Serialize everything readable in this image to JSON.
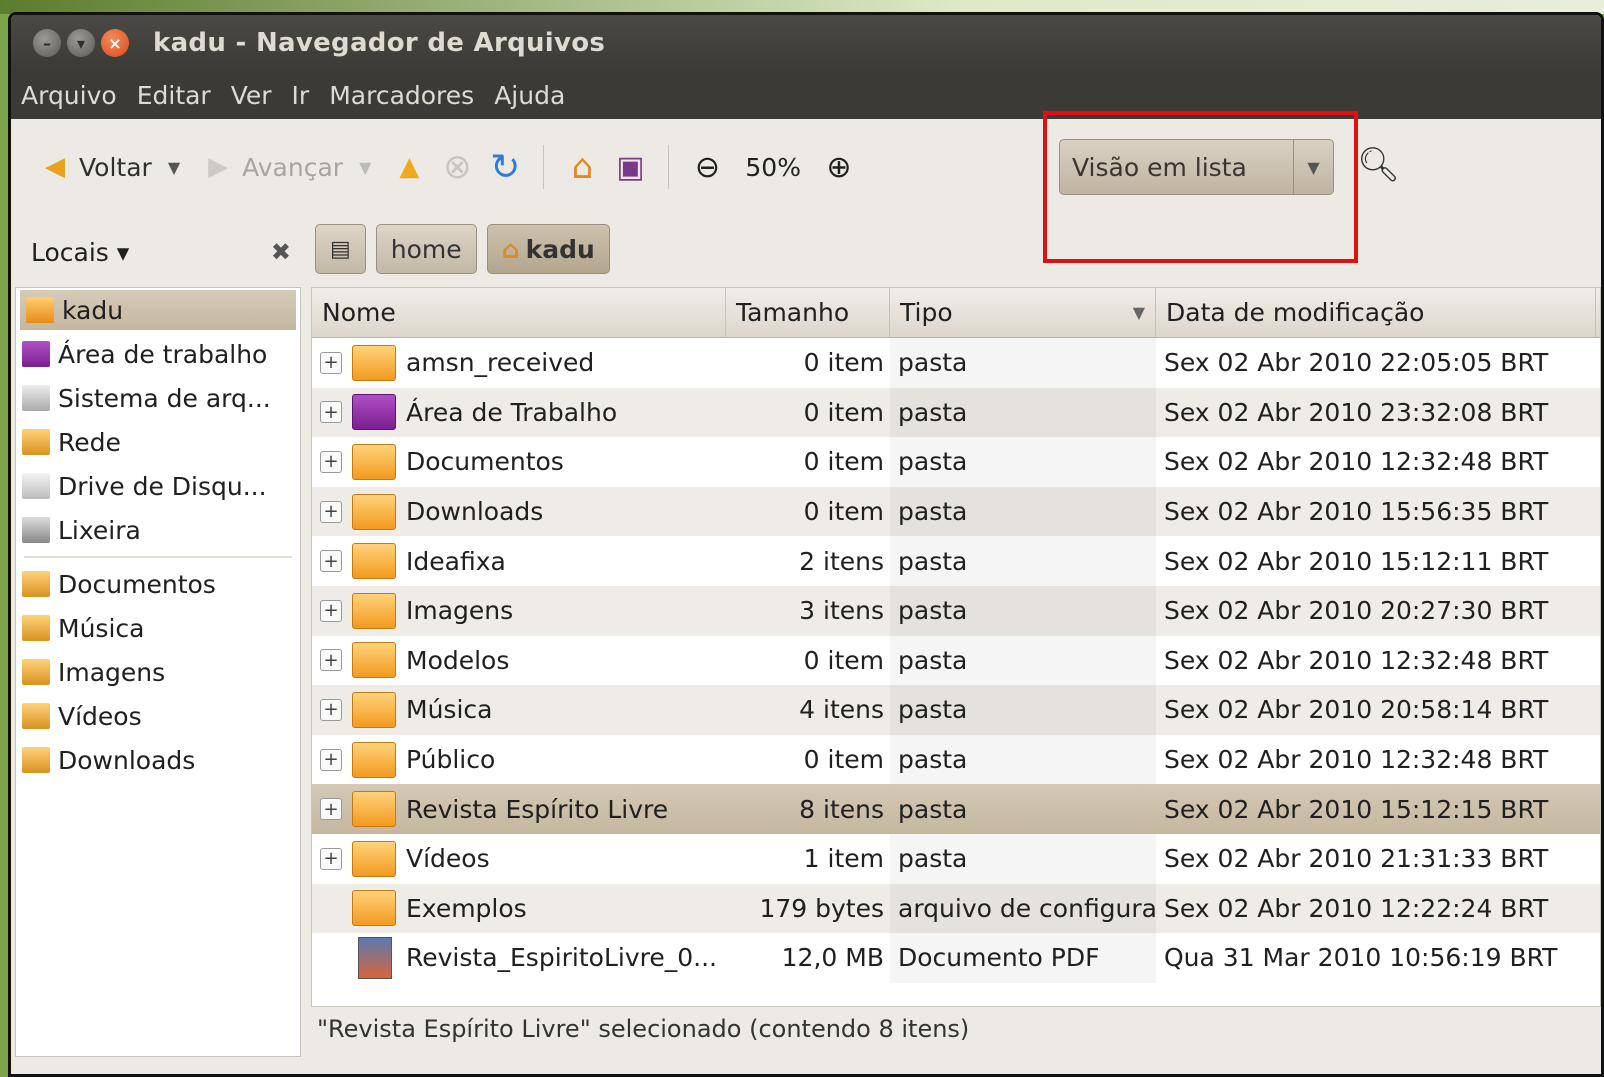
{
  "window": {
    "title": "kadu - Navegador de Arquivos"
  },
  "menu": [
    "Arquivo",
    "Editar",
    "Ver",
    "Ir",
    "Marcadores",
    "Ajuda"
  ],
  "toolbar": {
    "back": "Voltar",
    "forward": "Avançar",
    "zoom": "50%",
    "view_mode": "Visão em lista"
  },
  "sidebar": {
    "title": "Locais ▾",
    "items": [
      {
        "label": "kadu",
        "icon": "home-folder-icon"
      },
      {
        "label": "Área de trabalho",
        "icon": "desktop-icon"
      },
      {
        "label": "Sistema de arq...",
        "icon": "filesystem-icon"
      },
      {
        "label": "Rede",
        "icon": "network-icon"
      },
      {
        "label": "Drive de Disqu...",
        "icon": "floppy-icon"
      },
      {
        "label": "Lixeira",
        "icon": "trash-icon"
      }
    ],
    "bookmarks": [
      {
        "label": "Documentos",
        "icon": "documents-icon"
      },
      {
        "label": "Música",
        "icon": "music-icon"
      },
      {
        "label": "Imagens",
        "icon": "images-icon"
      },
      {
        "label": "Vídeos",
        "icon": "videos-icon"
      },
      {
        "label": "Downloads",
        "icon": "downloads-icon"
      }
    ]
  },
  "path": [
    "home",
    "kadu"
  ],
  "columns": {
    "name": "Nome",
    "size": "Tamanho",
    "type": "Tipo",
    "date": "Data de modificação"
  },
  "files": [
    {
      "name": "amsn_received",
      "size": "0 item",
      "type": "pasta",
      "date": "Sex 02 Abr 2010 22:05:05 BRT"
    },
    {
      "name": "Área de Trabalho",
      "size": "0 item",
      "type": "pasta",
      "date": "Sex 02 Abr 2010 23:32:08 BRT"
    },
    {
      "name": "Documentos",
      "size": "0 item",
      "type": "pasta",
      "date": "Sex 02 Abr 2010 12:32:48 BRT"
    },
    {
      "name": "Downloads",
      "size": "0 item",
      "type": "pasta",
      "date": "Sex 02 Abr 2010 15:56:35 BRT"
    },
    {
      "name": "Ideafixa",
      "size": "2 itens",
      "type": "pasta",
      "date": "Sex 02 Abr 2010 15:12:11 BRT"
    },
    {
      "name": "Imagens",
      "size": "3 itens",
      "type": "pasta",
      "date": "Sex 02 Abr 2010 20:27:30 BRT"
    },
    {
      "name": "Modelos",
      "size": "0 item",
      "type": "pasta",
      "date": "Sex 02 Abr 2010 12:32:48 BRT"
    },
    {
      "name": "Música",
      "size": "4 itens",
      "type": "pasta",
      "date": "Sex 02 Abr 2010 20:58:14 BRT"
    },
    {
      "name": "Público",
      "size": "0 item",
      "type": "pasta",
      "date": "Sex 02 Abr 2010 12:32:48 BRT"
    },
    {
      "name": "Revista Espírito Livre",
      "size": "8 itens",
      "type": "pasta",
      "date": "Sex 02 Abr 2010 15:12:15 BRT"
    },
    {
      "name": "Vídeos",
      "size": "1 item",
      "type": "pasta",
      "date": "Sex 02 Abr 2010 21:31:33 BRT"
    },
    {
      "name": "Exemplos",
      "size": "179 bytes",
      "type": "arquivo de configura",
      "date": "Sex 02 Abr 2010 12:22:24 BRT"
    },
    {
      "name": "Revista_EspiritoLivre_0...",
      "size": "12,0 MB",
      "type": "Documento PDF",
      "date": "Qua 31 Mar 2010 10:56:19 BRT"
    }
  ],
  "status": "\"Revista Espírito Livre\" selecionado (contendo 8 itens)"
}
